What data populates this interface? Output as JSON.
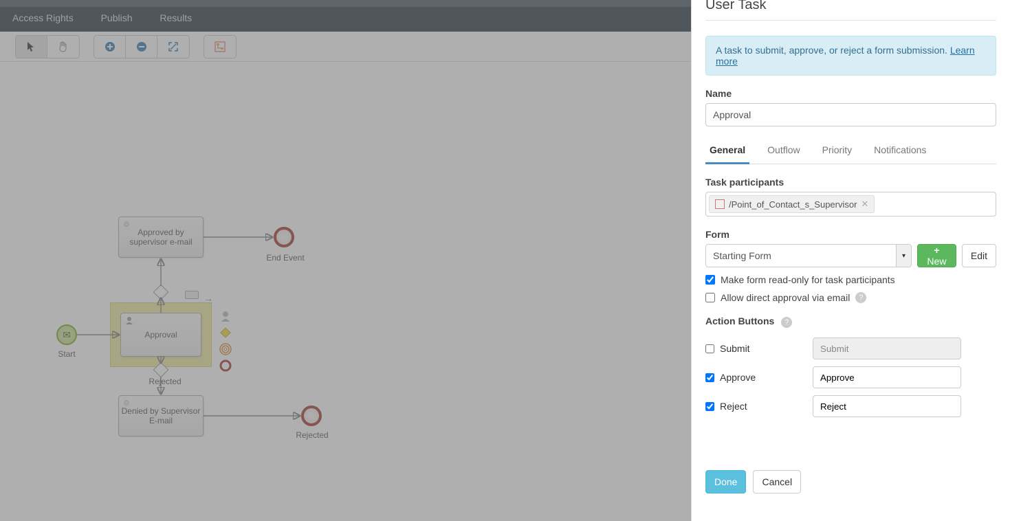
{
  "nav": {
    "access_rights": "Access Rights",
    "publish": "Publish",
    "results": "Results"
  },
  "canvas": {
    "start_label": "Start",
    "approval_label": "Approval",
    "approved_label": "Approved by supervisor e-mail",
    "denied_label": "Denied by Supervisor E-mail",
    "rejected_label": "Rejected",
    "rejected_end_label": "Rejected",
    "end_event_label": "End Event"
  },
  "panel": {
    "title": "User Task",
    "info_text": "A task to submit, approve, or reject a form submission. ",
    "learn_more": "Learn more",
    "name_label": "Name",
    "name_value": "Approval",
    "tabs": {
      "general": "General",
      "outflow": "Outflow",
      "priority": "Priority",
      "notifications": "Notifications"
    },
    "participants_label": "Task participants",
    "participant_token": "/Point_of_Contact_s_Supervisor",
    "form_label": "Form",
    "form_value": "Starting Form",
    "new_form_btn": "New form",
    "edit_btn": "Edit",
    "readonly_label": "Make form read-only for task participants",
    "direct_approval_label": "Allow direct approval via email",
    "action_buttons_label": "Action Buttons",
    "actions": {
      "submit": {
        "label": "Submit",
        "value": "Submit",
        "checked": false
      },
      "approve": {
        "label": "Approve",
        "value": "Approve",
        "checked": true
      },
      "reject": {
        "label": "Reject",
        "value": "Reject",
        "checked": true
      }
    },
    "done_btn": "Done",
    "cancel_btn": "Cancel"
  }
}
